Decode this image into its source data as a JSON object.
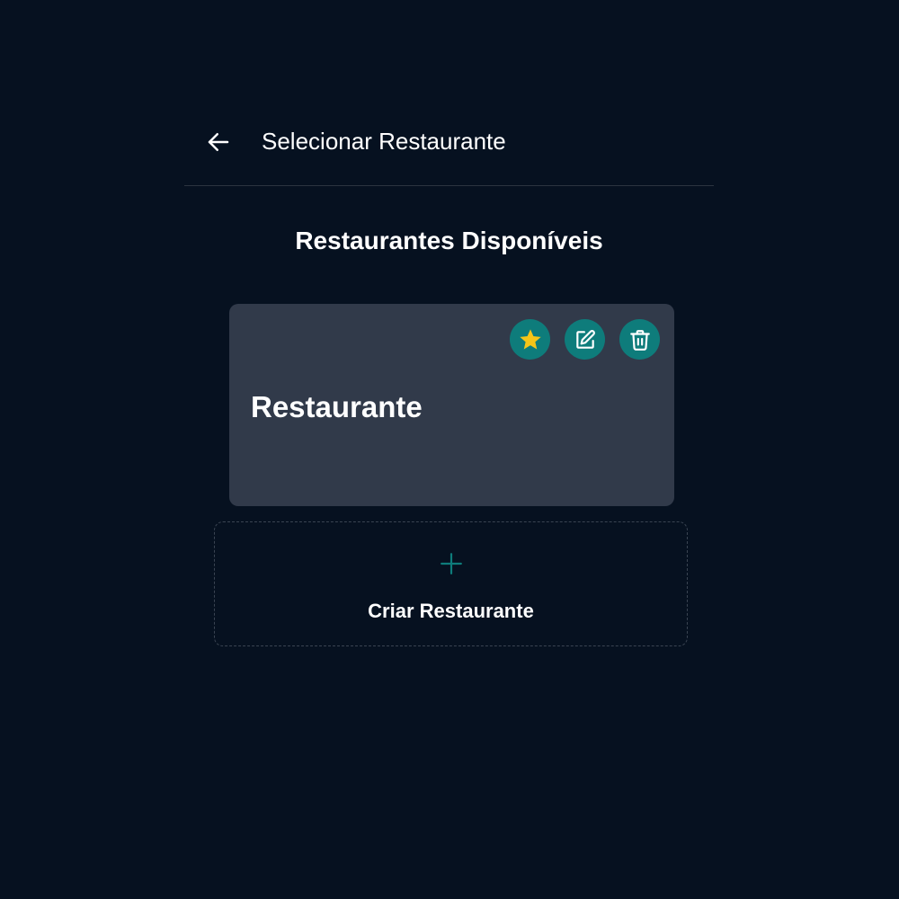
{
  "header": {
    "title": "Selecionar Restaurante",
    "back_icon": "arrow-left-icon"
  },
  "section": {
    "title": "Restaurantes Disponíveis"
  },
  "restaurants": [
    {
      "name": "Restaurante",
      "actions": [
        "star-icon",
        "edit-icon",
        "trash-icon"
      ]
    }
  ],
  "create": {
    "label": "Criar Restaurante",
    "icon": "plus-icon"
  },
  "colors": {
    "background": "#061120",
    "card": "#313a4a",
    "accent": "#0e7c7b",
    "star": "#f5c518"
  }
}
